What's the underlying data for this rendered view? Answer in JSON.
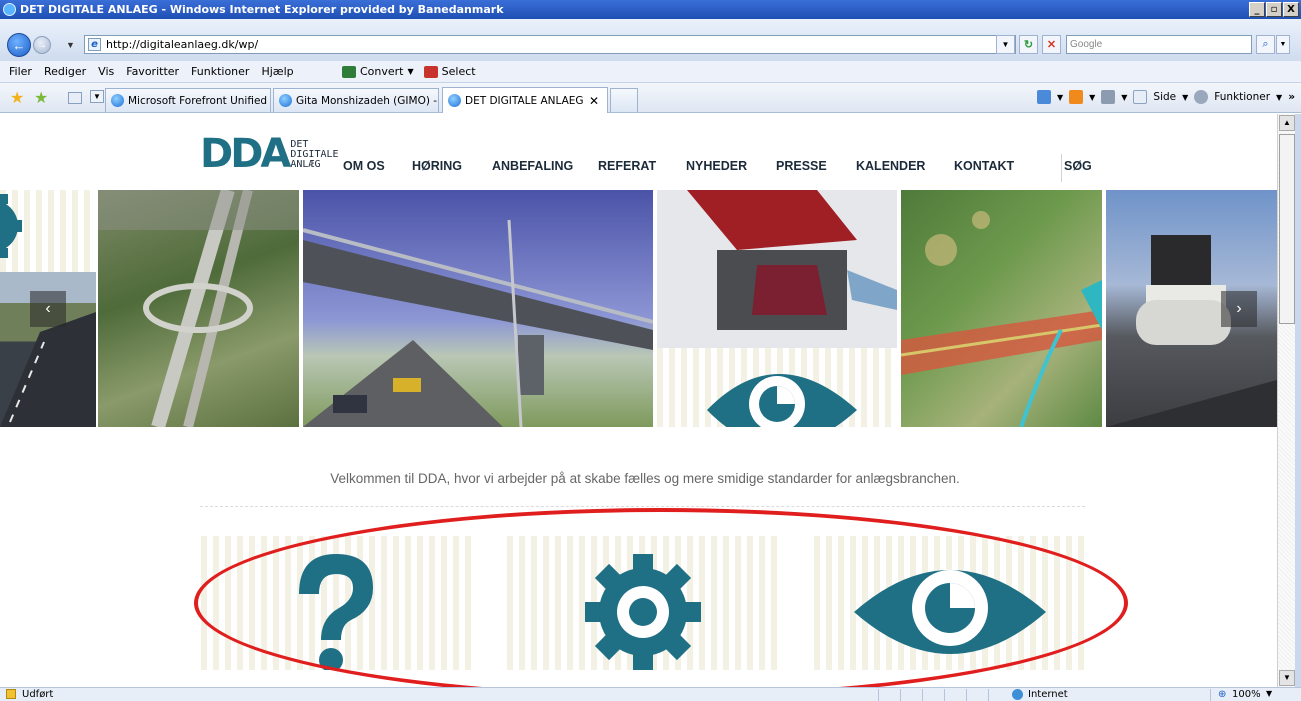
{
  "window": {
    "title": "DET DIGITALE ANLAEG - Windows Internet Explorer provided by Banedanmark",
    "buttons": [
      "_",
      "▫",
      "X"
    ]
  },
  "address": {
    "url": "http://digitaleanlaeg.dk/wp/",
    "search_placeholder": "Google"
  },
  "menu": {
    "items": [
      "Filer",
      "Rediger",
      "Vis",
      "Favoritter",
      "Funktioner",
      "Hjælp"
    ],
    "convert_label": "Convert",
    "select_label": "Select"
  },
  "tabs": [
    {
      "label": "Microsoft Forefront Unified ..."
    },
    {
      "label": "Gita Monshizadeh (GIMO) - ..."
    },
    {
      "label": "DET DIGITALE ANLAEG",
      "active": true
    }
  ],
  "command_bar": {
    "page_label": "Side",
    "tools_label": "Funktioner",
    "overflow": "»"
  },
  "site": {
    "logo_text": "DDA",
    "logo_sub": [
      "DET",
      "DIGITALE",
      "ANLÆG"
    ],
    "nav": [
      "OM OS",
      "HØRING",
      "ANBEFALING",
      "REFERAT",
      "NYHEDER",
      "PRESSE",
      "KALENDER",
      "KONTAKT",
      "SØG"
    ],
    "slider_prev": "‹",
    "slider_next": "›",
    "welcome": "Velkommen til DDA, hvor vi arbejder på at skabe fælles og mere smidige standarder for anlægsbranchen."
  },
  "features": [
    {
      "icon": "question-icon"
    },
    {
      "icon": "gear-icon"
    },
    {
      "icon": "eye-icon"
    }
  ],
  "status": {
    "text": "Udført",
    "zone": "Internet",
    "zoom": "100%"
  },
  "colors": {
    "brand_teal": "#1f6f85",
    "annotation_red": "#e11e1e"
  }
}
